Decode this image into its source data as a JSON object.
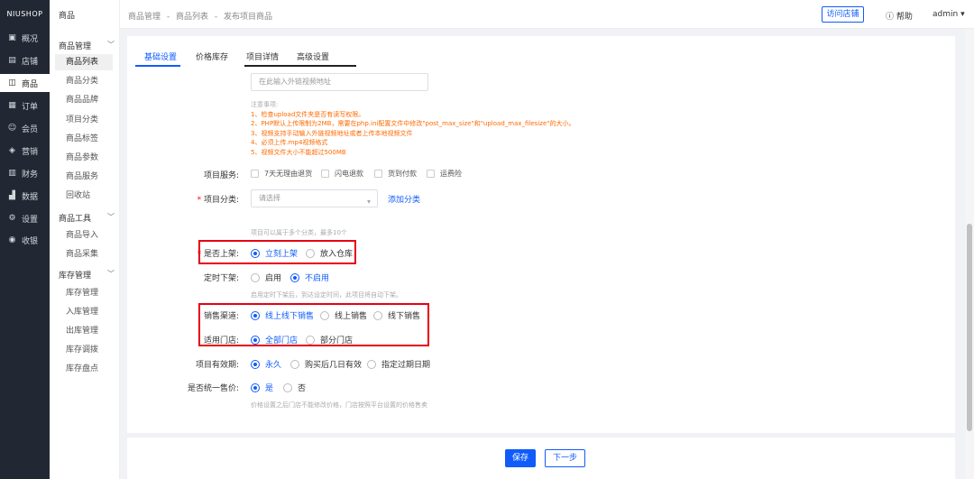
{
  "brand": "NIUSHOP",
  "main_nav": [
    {
      "label": "概况",
      "icon": "dashboard-icon"
    },
    {
      "label": "店铺",
      "icon": "store-icon"
    },
    {
      "label": "商品",
      "icon": "goods-icon"
    },
    {
      "label": "订单",
      "icon": "order-icon"
    },
    {
      "label": "会员",
      "icon": "member-icon"
    },
    {
      "label": "营销",
      "icon": "marketing-icon"
    },
    {
      "label": "财务",
      "icon": "finance-icon"
    },
    {
      "label": "数据",
      "icon": "data-icon"
    },
    {
      "label": "设置",
      "icon": "settings-icon"
    },
    {
      "label": "收银",
      "icon": "cashier-icon"
    }
  ],
  "sub_nav": {
    "title": "商品",
    "groups": [
      {
        "label": "商品管理",
        "items": [
          "商品列表",
          "商品分类",
          "商品品牌",
          "项目分类",
          "商品标签",
          "商品参数",
          "商品服务",
          "回收站"
        ]
      },
      {
        "label": "商品工具",
        "items": [
          "商品导入",
          "商品采集"
        ]
      },
      {
        "label": "库存管理",
        "items": [
          "库存管理",
          "入库管理",
          "出库管理",
          "库存调拨",
          "库存盘点"
        ]
      }
    ]
  },
  "header": {
    "breadcrumb": [
      "商品管理",
      "-",
      "商品列表",
      "-",
      "发布项目商品"
    ],
    "visit_store": "访问店铺",
    "help": "帮助",
    "user": "admin"
  },
  "tabs": [
    "基础设置",
    "价格库存",
    "项目详情",
    "高级设置"
  ],
  "video_url_placeholder": "在此输入外链视频地址",
  "notes": {
    "title": "注意事项:",
    "lines": [
      "1、检查upload文件夹是否有读写权限。",
      "2、PHP默认上传限制为2MB，需要在php.ini配置文件中修改\"post_max_size\"和\"upload_max_filesize\"的大小。",
      "3、视频支持手动输入外链视频地址或者上传本地视频文件",
      "4、必须上传.mp4视频格式",
      "5、视频文件大小不能超过500MB"
    ]
  },
  "service": {
    "label": "项目服务:",
    "options": [
      "7天无理由退货",
      "闪电退款",
      "货到付款",
      "运费险"
    ]
  },
  "category": {
    "label": "项目分类:",
    "placeholder": "请选择",
    "add_link": "添加分类",
    "hint": "项目可以属于多个分类，最多10个"
  },
  "on_shelf": {
    "label": "是否上架:",
    "options": [
      "立刻上架",
      "放入仓库"
    ],
    "selected": 0
  },
  "timed_off": {
    "label": "定时下架:",
    "options": [
      "启用",
      "不启用"
    ],
    "selected": 1,
    "hint": "启用定时下架后，到达设定时间，此项目将自动下架。"
  },
  "channel": {
    "label": "销售渠道:",
    "options": [
      "线上线下销售",
      "线上销售",
      "线下销售"
    ],
    "selected": 0
  },
  "stores": {
    "label": "适用门店:",
    "options": [
      "全部门店",
      "部分门店"
    ],
    "selected": 0
  },
  "validity": {
    "label": "项目有效期:",
    "options": [
      "永久",
      "购买后几日有效",
      "指定过期日期"
    ],
    "selected": 0
  },
  "unified_price": {
    "label": "是否统一售价:",
    "options": [
      "是",
      "否"
    ],
    "selected": 0,
    "hint": "价格设置之后门店不能修改价格，门店按照平台设置的价格售卖"
  },
  "footer": {
    "save": "保存",
    "next": "下一步"
  },
  "colors": {
    "primary": "#105cfb",
    "sidebar": "#222833",
    "highlight_box": "#e60012",
    "note": "#ff6a00"
  }
}
